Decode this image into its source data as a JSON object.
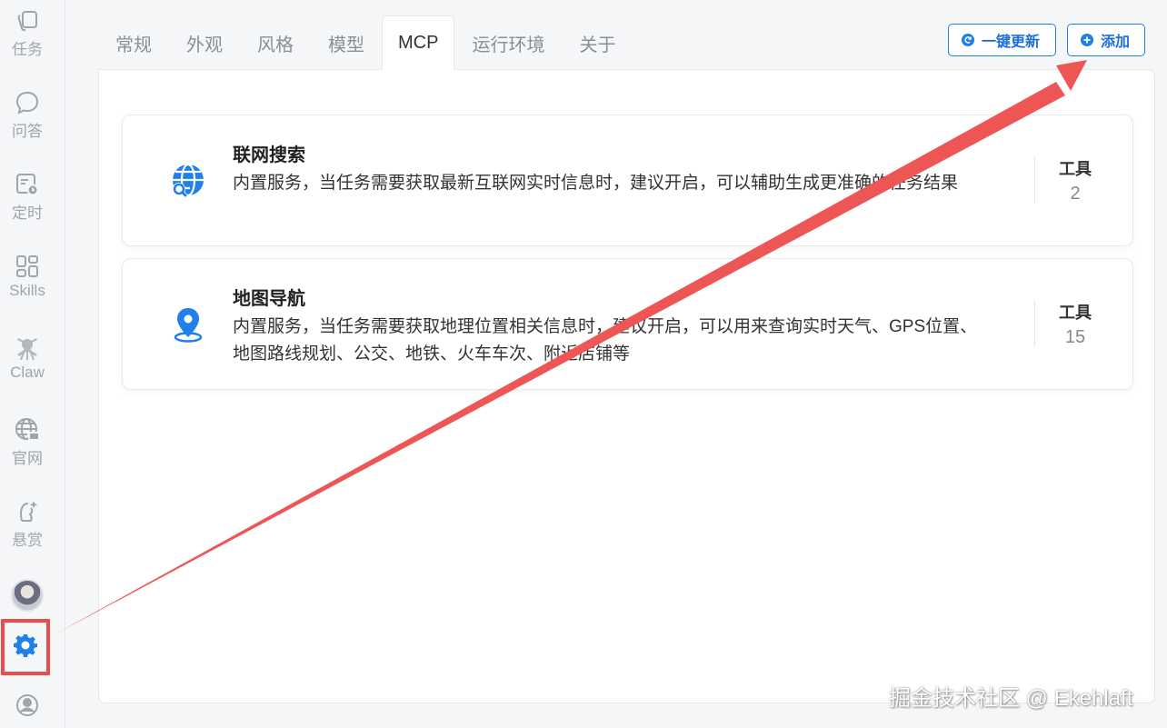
{
  "sidebar": {
    "items": [
      {
        "label": "任务",
        "icon": "tasks-icon"
      },
      {
        "label": "问答",
        "icon": "chat-icon"
      },
      {
        "label": "定时",
        "icon": "schedule-icon"
      },
      {
        "label": "Skills",
        "icon": "skills-icon"
      },
      {
        "label": "Claw",
        "icon": "claw-icon"
      },
      {
        "label": "官网",
        "icon": "website-icon"
      },
      {
        "label": "悬赏",
        "icon": "bounty-icon"
      }
    ],
    "bottom": [
      "avatar",
      "settings-icon",
      "user-icon"
    ]
  },
  "tabs": [
    {
      "label": "常规",
      "active": false
    },
    {
      "label": "外观",
      "active": false
    },
    {
      "label": "风格",
      "active": false
    },
    {
      "label": "模型",
      "active": false
    },
    {
      "label": "MCP",
      "active": true
    },
    {
      "label": "运行环境",
      "active": false
    },
    {
      "label": "关于",
      "active": false
    }
  ],
  "toolbar": {
    "update_label": "一键更新",
    "add_label": "添加"
  },
  "mcp_services": [
    {
      "name": "联网搜索",
      "icon": "globe-search-icon",
      "description": "内置服务，当任务需要获取最新互联网实时信息时，建议开启，可以辅助生成更准确的任务结果",
      "tools_label": "工具",
      "tools_count": "2"
    },
    {
      "name": "地图导航",
      "icon": "map-pin-icon",
      "description": "内置服务，当任务需要获取地理位置相关信息时，建议开启，可以用来查询实时天气、GPS位置、地图路线规划、公交、地铁、火车车次、附近店铺等",
      "tools_label": "工具",
      "tools_count": "15"
    }
  ],
  "watermark": "掘金技术社区 @ Ekehlaft",
  "colors": {
    "accent": "#1e80e8",
    "annotation": "#ea4d4d",
    "sidebar_text": "#a0a4ab"
  }
}
